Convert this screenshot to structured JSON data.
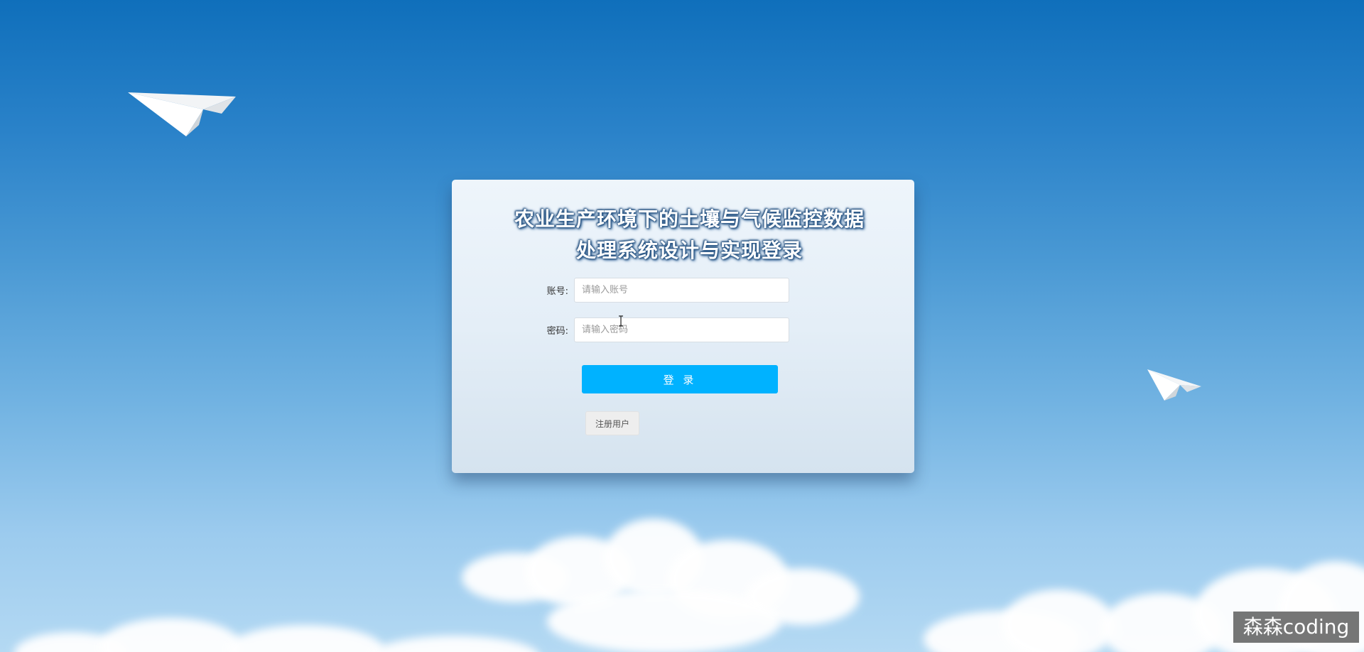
{
  "page": {
    "title_line1": "农业生产环境下的土壤与气候监控数据",
    "title_line2": "处理系统设计与实现登录"
  },
  "form": {
    "account_label": "账号:",
    "account_placeholder": "请输入账号",
    "account_value": "",
    "password_label": "密码:",
    "password_placeholder": "请输入密码",
    "password_value": "",
    "login_label": "登 录",
    "register_label": "注册用户"
  },
  "watermark": {
    "text": "森森coding"
  },
  "icons": {
    "plane_left": "paper-plane-icon",
    "plane_right": "paper-plane-icon",
    "cursor": "text-cursor-icon"
  },
  "colors": {
    "login_button": "#00b2ff",
    "sky_top": "#0f6fbb",
    "sky_bottom": "#b4d9f3"
  }
}
